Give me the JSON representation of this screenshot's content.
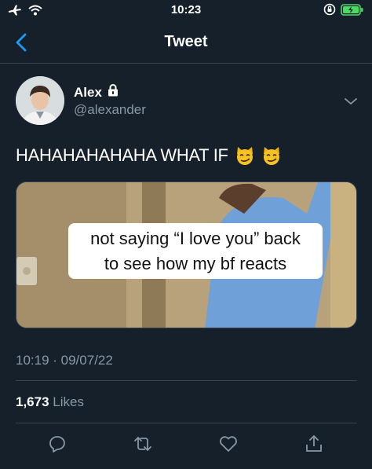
{
  "status_bar": {
    "time": "10:23",
    "icons": [
      "airplane-icon",
      "wifi-icon",
      "orientation-lock-icon",
      "battery-charging-icon"
    ]
  },
  "nav": {
    "title": "Tweet",
    "back_icon": "chevron-left-icon"
  },
  "tweet": {
    "author_name": "Alex",
    "author_handle": "@alexander",
    "protected_icon": "lock-icon",
    "text": "HAHAHAHAHAHA WHAT IF",
    "emojis": [
      "smirking-cat-emoji",
      "smirking-cat-emoji"
    ],
    "media_caption_line1": "not saying “I love you” back",
    "media_caption_line2": "to see how my bf reacts",
    "timestamp": "10:19 · 09/07/22",
    "likes_count": "1,673",
    "likes_label": "Likes"
  },
  "actions": [
    "reply-icon",
    "retweet-icon",
    "like-icon",
    "share-icon"
  ],
  "colors": {
    "background": "#15202b",
    "divider": "#38444d",
    "secondary_text": "#8899a6",
    "accent": "#1d9bf0"
  }
}
